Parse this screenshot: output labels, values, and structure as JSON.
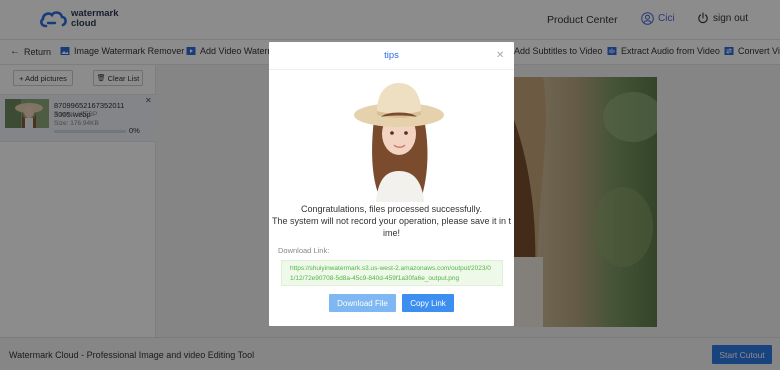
{
  "header": {
    "logo_line1": "watermark",
    "logo_line2": "cloud",
    "product_center": "Product Center",
    "user_name": "Cici",
    "sign_out": "sign out"
  },
  "toolbar": {
    "return": "Return",
    "items": [
      "Image Watermark Remover",
      "Add Video Waterma",
      "Add Subtitles to Video",
      "Extract Audio from Video",
      "Convert Vi"
    ]
  },
  "left_panel": {
    "add_pictures": "+ Add pictures",
    "clear_list": "Clear List",
    "file": {
      "name": "87099652167352011 3005.webp",
      "format": "Format: WEBP",
      "size": "Size: 176.94KB",
      "progress_value": 0,
      "progress_text": "0%"
    }
  },
  "footer": {
    "text": "Watermark Cloud - Professional Image and video Editing Tool",
    "start_button": "Start Cutout"
  },
  "modal": {
    "title": "tips",
    "message_line1": "Congratulations, files processed successfully.",
    "message_line2": "The system will not record your operation, please save it in t",
    "message_line3": "ime!",
    "download_label": "Download Link:",
    "download_link": "https://shuiyinwatermark.s3.us-west-2.amazonaws.com/output/2023/01/12/72e90708-5d8a-45c9-840d-459f1a30fa6e_output.png",
    "download_button": "Download File",
    "copy_button": "Copy Link"
  },
  "colors": {
    "accent": "#2d6cdf",
    "start_button": "#2d7be5",
    "copy_button": "#3c8ff0",
    "download_button": "#7fb7f3",
    "link_text": "#58b24b"
  }
}
